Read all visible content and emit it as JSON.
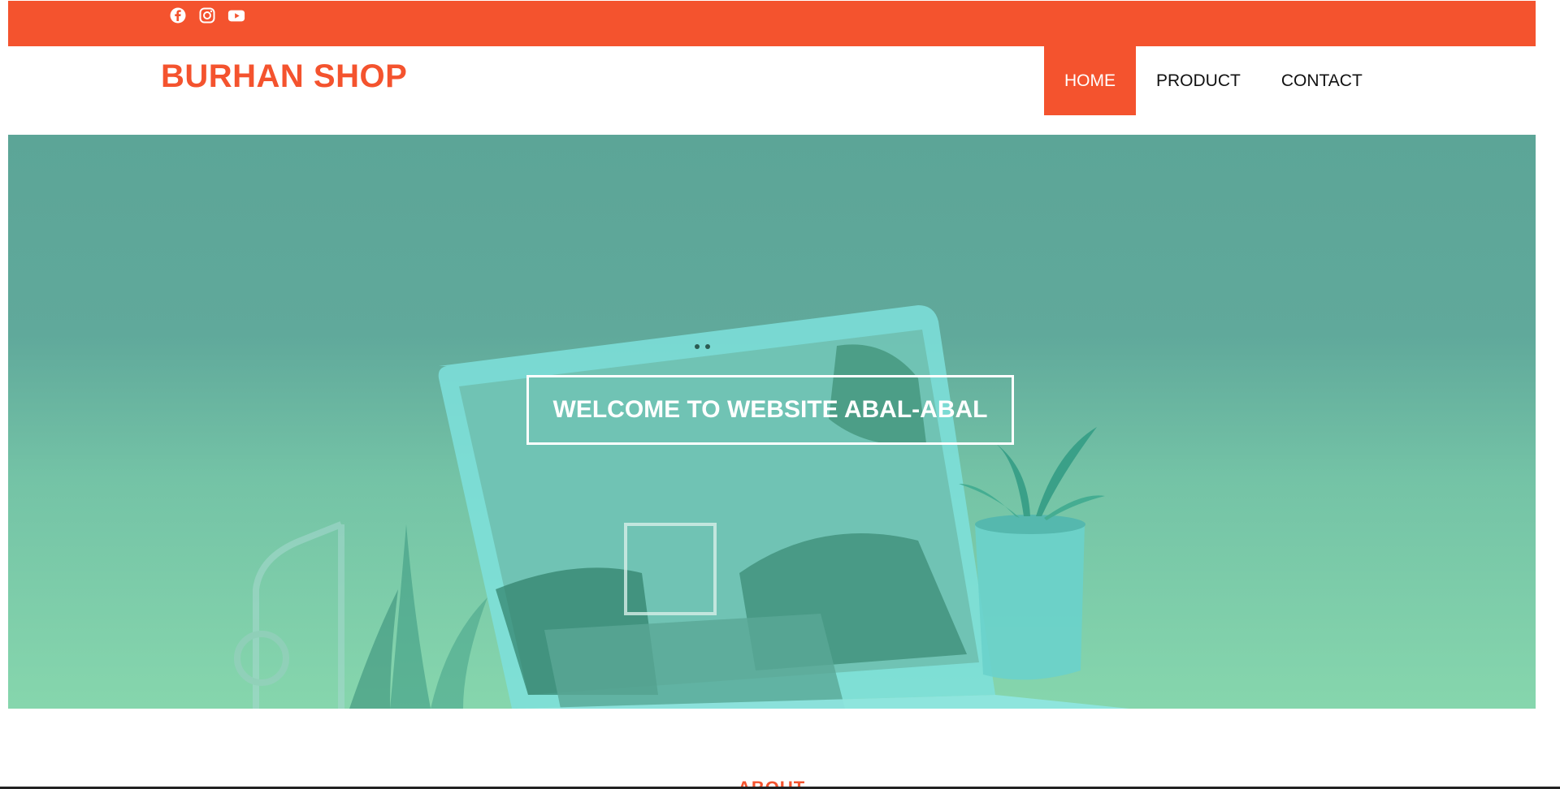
{
  "topbar": {
    "color": "#f4532e",
    "social_icons": [
      "facebook-icon",
      "instagram-icon",
      "youtube-icon"
    ]
  },
  "header": {
    "logo": "BURHAN SHOP",
    "nav": [
      {
        "label": "HOME",
        "active": true
      },
      {
        "label": "PRODUCT",
        "active": false
      },
      {
        "label": "CONTACT",
        "active": false
      }
    ]
  },
  "hero": {
    "title": "WELCOME TO WEBSITE ABAL-ABAL",
    "overlay_color": "#5ca597"
  },
  "about": {
    "heading": "ABOUT"
  }
}
